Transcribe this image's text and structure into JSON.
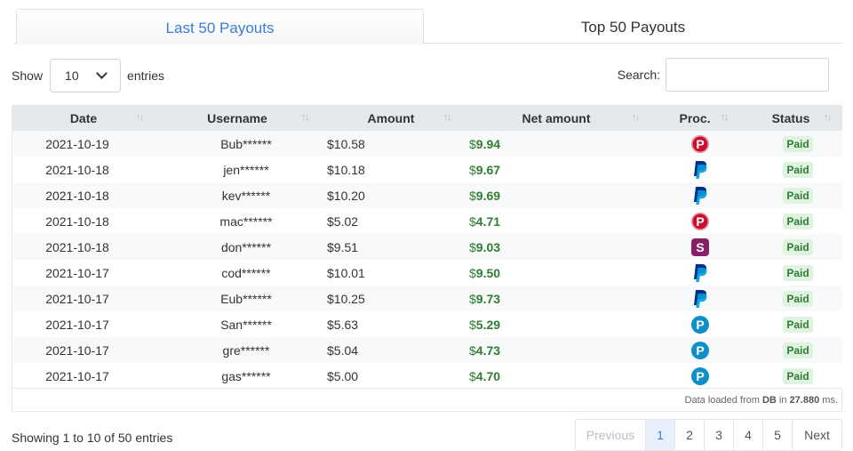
{
  "tabs": [
    {
      "label": "Last 50 Payouts",
      "active": true
    },
    {
      "label": "Top 50 Payouts",
      "active": false
    }
  ],
  "length": {
    "show_label": "Show",
    "value": "10",
    "entries_label": "entries"
  },
  "search": {
    "label": "Search:",
    "value": ""
  },
  "columns": [
    "Date",
    "Username",
    "Amount",
    "Net amount",
    "Proc.",
    "Status"
  ],
  "rows": [
    {
      "date": "2021-10-19",
      "user": "Bub******",
      "amount": "$10.58",
      "net_cur": "$",
      "net": "9.94",
      "proc": "payeer-icon",
      "status": "Paid"
    },
    {
      "date": "2021-10-18",
      "user": "jen******",
      "amount": "$10.18",
      "net_cur": "$",
      "net": "9.67",
      "proc": "paypal-icon",
      "status": "Paid"
    },
    {
      "date": "2021-10-18",
      "user": "kev******",
      "amount": "$10.20",
      "net_cur": "$",
      "net": "9.69",
      "proc": "paypal-icon",
      "status": "Paid"
    },
    {
      "date": "2021-10-18",
      "user": "mac******",
      "amount": "$5.02",
      "net_cur": "$",
      "net": "4.71",
      "proc": "payeer-icon",
      "status": "Paid"
    },
    {
      "date": "2021-10-18",
      "user": "don******",
      "amount": "$9.51",
      "net_cur": "$",
      "net": "9.03",
      "proc": "skrill-icon",
      "status": "Paid"
    },
    {
      "date": "2021-10-17",
      "user": "cod******",
      "amount": "$10.01",
      "net_cur": "$",
      "net": "9.50",
      "proc": "paypal-icon",
      "status": "Paid"
    },
    {
      "date": "2021-10-17",
      "user": "Eub******",
      "amount": "$10.25",
      "net_cur": "$",
      "net": "9.73",
      "proc": "paypal-icon",
      "status": "Paid"
    },
    {
      "date": "2021-10-17",
      "user": "San******",
      "amount": "$5.63",
      "net_cur": "$",
      "net": "5.29",
      "proc": "paysafe-icon",
      "status": "Paid"
    },
    {
      "date": "2021-10-17",
      "user": "gre******",
      "amount": "$5.04",
      "net_cur": "$",
      "net": "4.73",
      "proc": "paysafe-icon",
      "status": "Paid"
    },
    {
      "date": "2021-10-17",
      "user": "gas******",
      "amount": "$5.00",
      "net_cur": "$",
      "net": "4.70",
      "proc": "paysafe-icon",
      "status": "Paid"
    }
  ],
  "footnote": {
    "prefix": "Data loaded from ",
    "source": "DB",
    "mid": " in ",
    "time": "27.880",
    "suffix": " ms."
  },
  "info": "Showing 1 to 10 of 50 entries",
  "pagination": {
    "previous": "Previous",
    "pages": [
      "1",
      "2",
      "3",
      "4",
      "5"
    ],
    "current": "1",
    "next": "Next"
  },
  "colors": {
    "accent": "#3d7bd9",
    "net_green": "#2e7d32",
    "paid_bg": "#dff3e0",
    "header_bg": "#e5e8ec"
  }
}
